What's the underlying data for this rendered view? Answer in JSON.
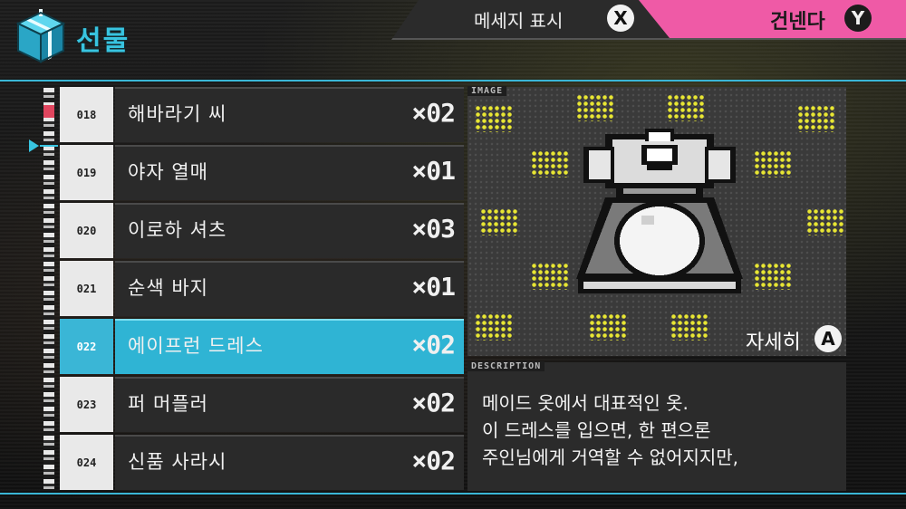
{
  "header": {
    "title": "선물",
    "message_toggle_label": "메세지 표시",
    "message_toggle_button": "X",
    "skip_label": "건넨다",
    "skip_button": "Y"
  },
  "icons": {
    "header_icon": "gift-box-icon",
    "list_cursor": "triangle-right-icon"
  },
  "gift_list": [
    {
      "number": "018",
      "name": "해바라기 씨",
      "quantity": "×02"
    },
    {
      "number": "019",
      "name": "야자 열매",
      "quantity": "×01"
    },
    {
      "number": "020",
      "name": "이로하 셔츠",
      "quantity": "×03"
    },
    {
      "number": "021",
      "name": "순색 바지",
      "quantity": "×01"
    },
    {
      "number": "022",
      "name": "에이프런 드레스",
      "quantity": "×02"
    },
    {
      "number": "023",
      "name": "퍼 머플러",
      "quantity": "×02"
    },
    {
      "number": "024",
      "name": "신품 사라시",
      "quantity": "×02"
    }
  ],
  "selected_index": 4,
  "image_panel": {
    "tag": "IMAGE",
    "item_icon": "apron-dress-icon",
    "detail_label": "자세히",
    "detail_button": "A"
  },
  "description": {
    "tag": "DESCRIPTION",
    "text": "메이드 옷에서 대표적인 옷.\n이 드레스를 입으면, 한 편으론\n주인님에게 거역할 수 없어지지만,"
  },
  "colors": {
    "accent": "#3ab6d6",
    "skip_bar": "#ef5aa6",
    "dot_pattern": "#e8e633"
  }
}
